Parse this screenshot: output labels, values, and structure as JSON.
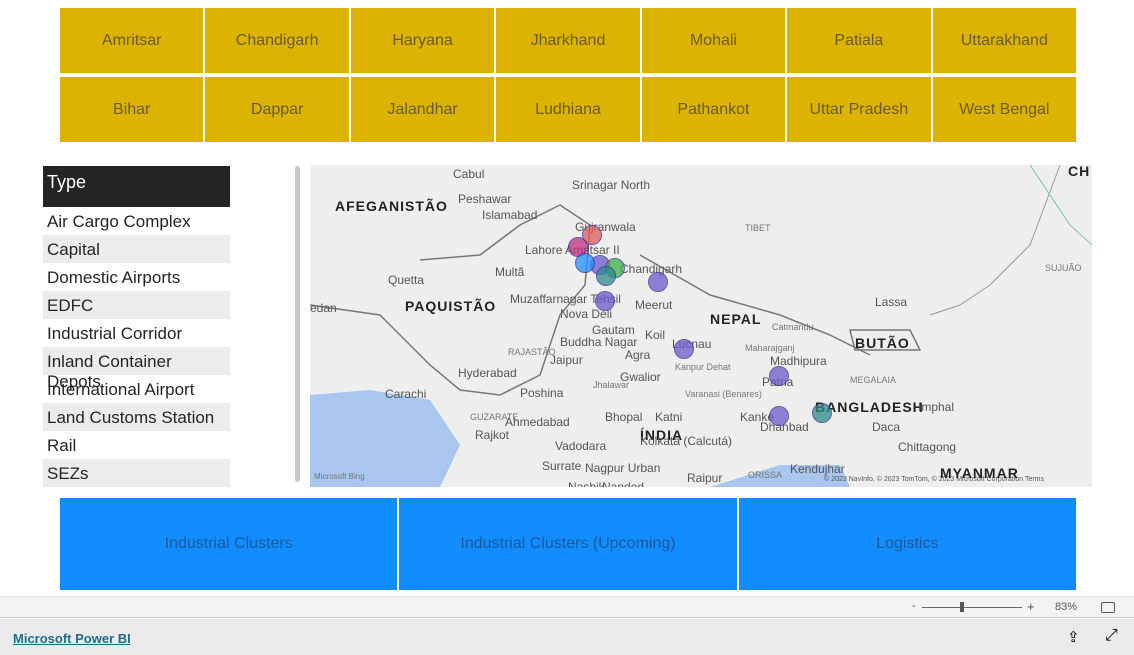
{
  "top_tiles": [
    "Amritsar",
    "Chandigarh",
    "Haryana",
    "Jharkhand",
    "Mohali",
    "Patiala",
    "Uttarakhand",
    "Bihar",
    "Dappar",
    "Jalandhar",
    "Ludhiana",
    "Pathankot",
    "Uttar Pradesh",
    "West Bengal"
  ],
  "slicer": {
    "title": "Type",
    "items": [
      "Air Cargo Complex",
      "Capital",
      "Domestic Airports",
      "EDFC",
      "Industrial Corridor",
      "Inland Container Depots",
      "International Airport",
      "Land Customs Station",
      "Rail",
      "SEZs"
    ]
  },
  "map": {
    "labels": [
      "Cabul",
      "Peshawar",
      "Islamabad",
      "Srinagar North",
      "AFEGANISTÃO",
      "Gujranwala",
      "Lahore",
      "Amritsar II",
      "Multã",
      "Chandigarh",
      "Quetta",
      "PAQUISTÃO",
      "Muzaffarnagar Tehsil",
      "Meerut",
      "Nova Deli",
      "Gautam",
      "Buddha Nagar",
      "Koil",
      "Jaipur",
      "Agra",
      "Lucnau",
      "Kanpur Dehat",
      "Hyderabad",
      "Gwalior",
      "Carachi",
      "Poshina",
      "Jhalawar",
      "Varanasi (Benares)",
      "Ahmedabad",
      "Bhopal",
      "Katni",
      "ÍNDIA",
      "Rajkot",
      "Vadodara",
      "Surrate",
      "Nagpur Urban",
      "Nashik",
      "Nanded",
      "Raipur",
      "TIBET",
      "Lassa",
      "NEPAL",
      "Catmandu",
      "Maharajganj",
      "BUTÃO",
      "Madhipura",
      "Patna",
      "Kanke",
      "Dhanbad",
      "BANGLADESH",
      "Imphal",
      "Kolkata (Calcutá)",
      "Daca",
      "Chittagong",
      "Kendujhar",
      "MYANMAR",
      "SUJUÃO",
      "CH",
      "edan",
      "RAJASTÃO",
      "GUZARATE",
      "MEGALAIA",
      "ORISSA"
    ],
    "attribution": "Microsoft Bing",
    "copyright": "© 2023 NavInfo, © 2023 TomTom, © 2023 Microsoft Corporation  Terms",
    "bubble_colors": [
      "#e05a5a",
      "#6a5acd",
      "#3cb043",
      "#2e8b8b",
      "#1e90ff",
      "#e07a3a",
      "#c03080"
    ]
  },
  "bottom_tiles": [
    "Industrial Clusters",
    "Industrial Clusters (Upcoming)",
    "Logistics"
  ],
  "zoom": {
    "minus": "-",
    "plus": "+",
    "level": "83%",
    "value": 83
  },
  "footer": {
    "brand": "Microsoft Power BI"
  }
}
